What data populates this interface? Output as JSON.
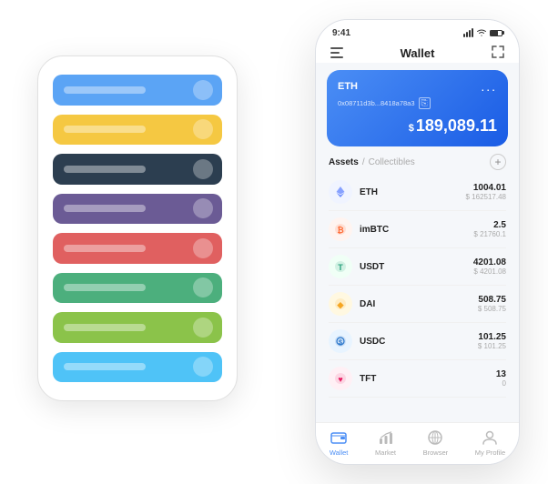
{
  "scene": {
    "back_phone": {
      "cards": [
        {
          "color": "card-blue",
          "label": ""
        },
        {
          "color": "card-yellow",
          "label": ""
        },
        {
          "color": "card-dark",
          "label": ""
        },
        {
          "color": "card-purple",
          "label": ""
        },
        {
          "color": "card-red",
          "label": ""
        },
        {
          "color": "card-green",
          "label": ""
        },
        {
          "color": "card-light-green",
          "label": ""
        },
        {
          "color": "card-blue2",
          "label": ""
        }
      ]
    },
    "front_phone": {
      "status_bar": {
        "time": "9:41",
        "signal": "●●●",
        "wifi": "wifi",
        "battery": "battery"
      },
      "nav": {
        "menu_icon": "☰",
        "title": "Wallet",
        "expand_icon": "⤢"
      },
      "eth_card": {
        "name": "ETH",
        "address": "0x08711d3b...8418a78a3",
        "copy_icon": "⎘",
        "dots": "...",
        "currency_symbol": "$",
        "amount": "189,089.11"
      },
      "assets_section": {
        "tab_active": "Assets",
        "separator": "/",
        "tab_inactive": "Collectibles",
        "add_icon": "+"
      },
      "assets": [
        {
          "icon": "◈",
          "icon_class": "icon-eth",
          "name": "ETH",
          "amount": "1004.01",
          "usd": "$ 162517.48"
        },
        {
          "icon": "₿",
          "icon_class": "icon-imbtc",
          "name": "imBTC",
          "amount": "2.5",
          "usd": "$ 21760.1"
        },
        {
          "icon": "T",
          "icon_class": "icon-usdt",
          "name": "USDT",
          "amount": "4201.08",
          "usd": "$ 4201.08"
        },
        {
          "icon": "◆",
          "icon_class": "icon-dai",
          "name": "DAI",
          "amount": "508.75",
          "usd": "$ 508.75"
        },
        {
          "icon": "◎",
          "icon_class": "icon-usdc",
          "name": "USDC",
          "amount": "101.25",
          "usd": "$ 101.25"
        },
        {
          "icon": "♥",
          "icon_class": "icon-tft",
          "name": "TFT",
          "amount": "13",
          "usd": "0"
        }
      ],
      "bottom_nav": [
        {
          "label": "Wallet",
          "active": true,
          "icon": "wallet"
        },
        {
          "label": "Market",
          "active": false,
          "icon": "market"
        },
        {
          "label": "Browser",
          "active": false,
          "icon": "browser"
        },
        {
          "label": "My Profile",
          "active": false,
          "icon": "profile"
        }
      ]
    }
  }
}
